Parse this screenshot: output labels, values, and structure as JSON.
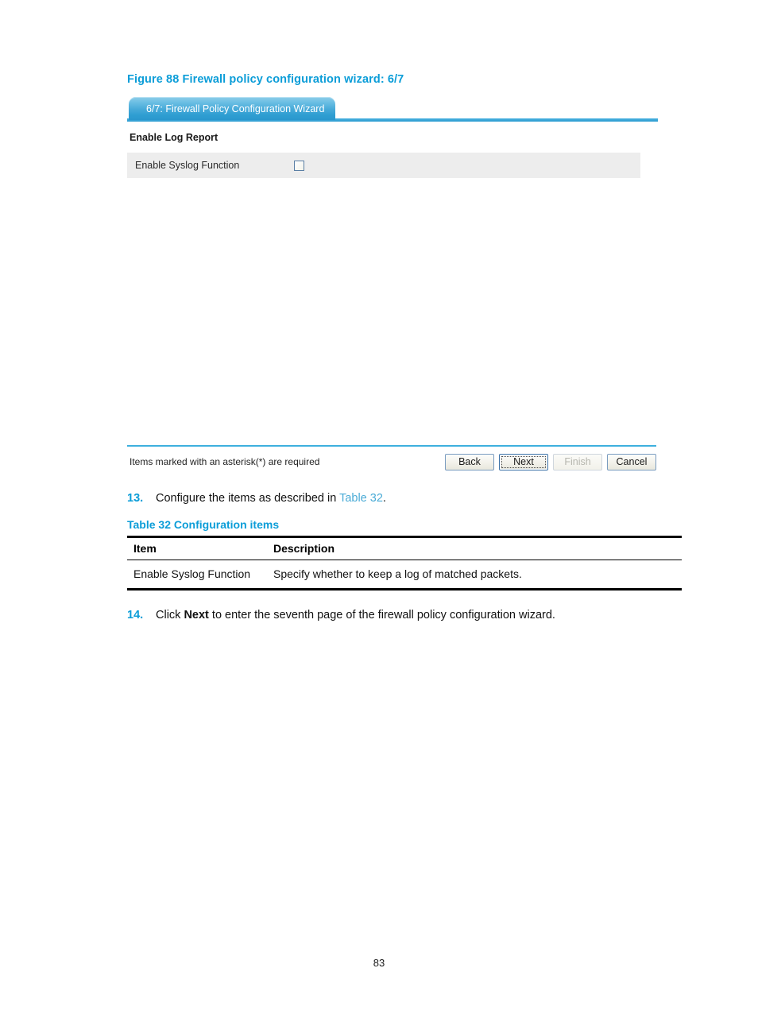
{
  "figure": {
    "caption": "Figure 88 Firewall policy configuration wizard: 6/7"
  },
  "wizard": {
    "tab_label": "6/7: Firewall Policy Configuration Wizard",
    "section_heading": "Enable Log Report",
    "fields": [
      {
        "label": "Enable Syslog Function",
        "type": "checkbox",
        "checked": false
      }
    ],
    "footer_note": "Items marked with an asterisk(*) are required",
    "buttons": [
      {
        "label": "Back",
        "state": "normal"
      },
      {
        "label": "Next",
        "state": "focused"
      },
      {
        "label": "Finish",
        "state": "disabled"
      },
      {
        "label": "Cancel",
        "state": "normal"
      }
    ]
  },
  "steps": [
    {
      "number": "13.",
      "text_before": "Configure the items as described in ",
      "link": "Table 32",
      "text_after": "."
    },
    {
      "number": "14.",
      "text_before": "Click ",
      "bold": "Next",
      "text_after": " to enter the seventh page of the firewall policy configuration wizard."
    }
  ],
  "table": {
    "caption": "Table 32 Configuration items",
    "headers": [
      "Item",
      "Description"
    ],
    "rows": [
      {
        "item": "Enable Syslog Function",
        "description": "Specify whether to keep a log of matched packets."
      }
    ]
  },
  "page_number": "83",
  "colors": {
    "heading_blue": "#0b9dd8",
    "link_blue": "#4aabd6",
    "tab_blue": "#2f9ed2",
    "row_gray": "#ededed"
  }
}
